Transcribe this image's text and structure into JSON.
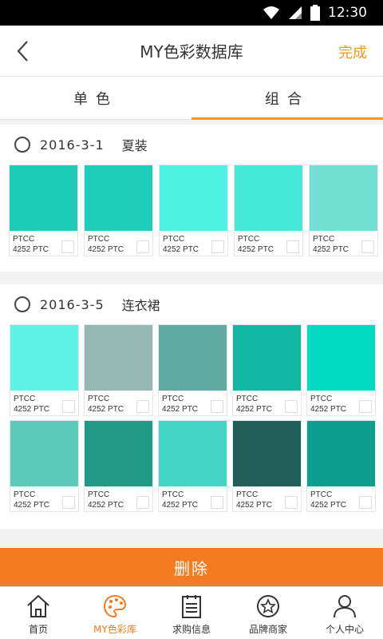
{
  "status_bar": {
    "time": "12:30"
  },
  "header": {
    "title": "MY色彩数据库",
    "done_label": "完成"
  },
  "tabs": [
    {
      "label": "单色",
      "active": false
    },
    {
      "label": "组合",
      "active": true
    }
  ],
  "groups": [
    {
      "date": "2016-3-1",
      "name": "夏装",
      "rows": [
        [
          {
            "color": "#1ecbb8",
            "line1": "PTCC",
            "line2": "4252 PTC"
          },
          {
            "color": "#1fcdbb",
            "line1": "PTCC",
            "line2": "4252 PTC"
          },
          {
            "color": "#4df2e0",
            "line1": "PTCC",
            "line2": "4252 PTC"
          },
          {
            "color": "#45e8d8",
            "line1": "PTCC",
            "line2": "4252 PTC"
          },
          {
            "color": "#72e0d5",
            "line1": "PTCC",
            "line2": "4252 PTC"
          }
        ]
      ]
    },
    {
      "date": "2016-3-5",
      "name": "连衣裙",
      "rows": [
        [
          {
            "color": "#5ff3e6",
            "line1": "PTCC",
            "line2": "4252 PTC"
          },
          {
            "color": "#96b8b3",
            "line1": "PTCC",
            "line2": "4252 PTC"
          },
          {
            "color": "#60aca3",
            "line1": "PTCC",
            "line2": "4252 PTC"
          },
          {
            "color": "#14b7a2",
            "line1": "PTCC",
            "line2": "4252 PTC"
          },
          {
            "color": "#00dbc2",
            "line1": "PTCC",
            "line2": "4252 PTC"
          }
        ],
        [
          {
            "color": "#5bcab9",
            "line1": "PTCC",
            "line2": "4252 PTC"
          },
          {
            "color": "#1e9a86",
            "line1": "PTCC",
            "line2": "4252 PTC"
          },
          {
            "color": "#45d5c4",
            "line1": "PTCC",
            "line2": "4252 PTC"
          },
          {
            "color": "#225f58",
            "line1": "PTCC",
            "line2": "4252 PTC"
          },
          {
            "color": "#0ea08e",
            "line1": "PTCC",
            "line2": "4252 PTC"
          }
        ]
      ]
    }
  ],
  "delete_label": "删除",
  "bottom_nav": [
    {
      "label": "首页",
      "icon": "home-icon",
      "active": false
    },
    {
      "label": "MY色彩库",
      "icon": "palette-icon",
      "active": true
    },
    {
      "label": "求购信息",
      "icon": "list-icon",
      "active": false
    },
    {
      "label": "品牌商家",
      "icon": "brand-badge-icon",
      "active": false
    },
    {
      "label": "个人中心",
      "icon": "person-icon",
      "active": false
    }
  ],
  "colors": {
    "accent": "#f47b20",
    "tab_indicator": "#f7941d"
  }
}
